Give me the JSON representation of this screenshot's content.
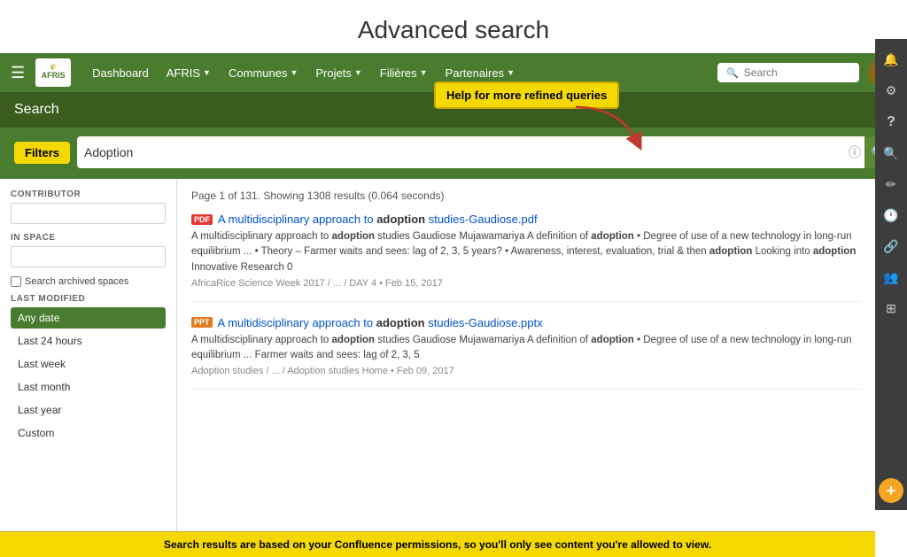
{
  "page": {
    "title": "Advanced search"
  },
  "topnav": {
    "logo": "AFRIS",
    "links": [
      {
        "label": "Dashboard",
        "hasDropdown": false
      },
      {
        "label": "AFRIS",
        "hasDropdown": true
      },
      {
        "label": "Communes",
        "hasDropdown": true
      },
      {
        "label": "Projets",
        "hasDropdown": true
      },
      {
        "label": "Filières",
        "hasDropdown": true
      },
      {
        "label": "Partenaires",
        "hasDropdown": true
      }
    ],
    "search_placeholder": "Search"
  },
  "subheader": {
    "title": "Search"
  },
  "tooltip": {
    "text": "Help for more refined queries"
  },
  "filters": {
    "label": "Filters",
    "search_value": "Adoption",
    "contributor_label": "CONTRIBUTOR",
    "in_space_label": "IN SPACE",
    "archived_label": "Search archived spaces",
    "last_modified_label": "LAST MODIFIED",
    "date_options": [
      {
        "label": "Any date",
        "active": true
      },
      {
        "label": "Last 24 hours",
        "active": false
      },
      {
        "label": "Last week",
        "active": false
      },
      {
        "label": "Last month",
        "active": false
      },
      {
        "label": "Last year",
        "active": false
      },
      {
        "label": "Custom",
        "active": false
      }
    ]
  },
  "results": {
    "meta": "Page 1 of 131. Showing 1308 results (0.064 seconds)",
    "items": [
      {
        "icon": "PDF",
        "title_prefix": "A multidisciplinary approach to ",
        "title_highlight": "adoption",
        "title_suffix": " studies-Gaudiose.pdf",
        "snippet": "A multidisciplinary approach to adoption studies Gaudiose Mujawamariya A definition of adoption • Degree of use of a new technology in long-run equilibrium ... • Theory – Farmer waits and sees: lag of 2, 3, 5 years? • Awareness, interest, evaluation, trial & then adoption Looking into adoption Innovative Research 0",
        "path": "AfricaRice Science Week 2017 / ... / DAY 4 • Feb 15, 2017"
      },
      {
        "icon": "PPT",
        "title_prefix": "A multidisciplinary approach to ",
        "title_highlight": "adoption",
        "title_suffix": " studies-Gaudiose.pptx",
        "snippet": "A multidisciplinary approach to adoption studies Gaudiose Mujawamariya A definition of adoption • Degree of use of a new technology in long-run equilibrium ... Farmer waits and sees: lag of 2, 3, 5",
        "path": "Adoption studies / ... / Adoption studies Home • Feb 09, 2017"
      }
    ]
  },
  "bottom_banner": {
    "text": "Search results are based on your Confluence permissions, so you'll only see content you're allowed to view."
  },
  "sidebar_icons": [
    {
      "name": "notification-icon",
      "symbol": "🔔"
    },
    {
      "name": "settings-icon",
      "symbol": "⚙"
    },
    {
      "name": "help-icon",
      "symbol": "?"
    },
    {
      "name": "search-icon",
      "symbol": "🔍"
    },
    {
      "name": "edit-icon",
      "symbol": "✏"
    },
    {
      "name": "clock-icon",
      "symbol": "🕐"
    },
    {
      "name": "link-icon",
      "symbol": "🔗"
    },
    {
      "name": "people-icon",
      "symbol": "👥"
    },
    {
      "name": "apps-icon",
      "symbol": "⊞"
    }
  ],
  "add_button": {
    "label": "+"
  }
}
